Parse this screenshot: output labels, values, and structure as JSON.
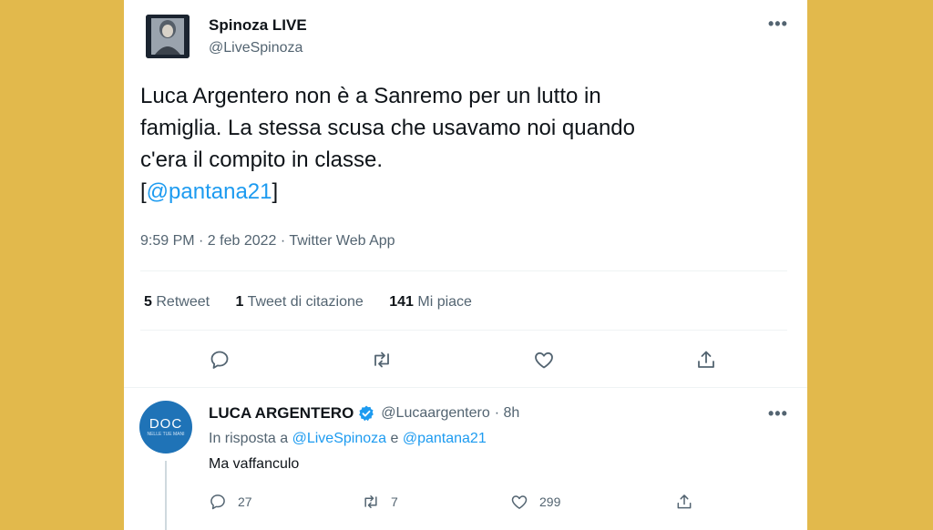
{
  "tweet": {
    "author_name": "Spinoza LIVE",
    "author_handle": "@LiveSpinoza",
    "more": "•••",
    "text_lines": [
      "Luca Argentero non è a Sanremo per un lutto in",
      "famiglia. La stessa scusa che usavamo noi quando",
      "c'era il compito in classe."
    ],
    "credit_open": "[",
    "credit_mention": "@pantana21",
    "credit_close": "]",
    "timestamp": "9:59 PM · 2 feb 2022 · Twitter Web App",
    "stats": {
      "retweets_count": "5",
      "retweets_label": "Retweet",
      "quotes_count": "1",
      "quotes_label": "Tweet di citazione",
      "likes_count": "141",
      "likes_label": "Mi piace"
    }
  },
  "reply": {
    "avatar_text": "DOC",
    "avatar_subtext": "NELLE TUE MANI",
    "author_name": "LUCA ARGENTERO",
    "author_handle": "@Lucaargentero",
    "time": "· 8h",
    "more": "•••",
    "in_reply_prefix": "In risposta a",
    "mention1": "@LiveSpinoza",
    "conj": "e",
    "mention2": "@pantana21",
    "text": "Ma vaffanculo",
    "replies": "27",
    "retweets": "7",
    "likes": "299"
  },
  "colors": {
    "background": "#e2b94c",
    "card": "#ffffff",
    "accent": "#1d9bf0",
    "secondary_text": "#536471",
    "verified": "#1d9bf0",
    "doc_avatar": "#1f73b7"
  },
  "icons": [
    "reply-icon",
    "retweet-icon",
    "like-icon",
    "share-icon",
    "verified-icon",
    "more-icon"
  ]
}
